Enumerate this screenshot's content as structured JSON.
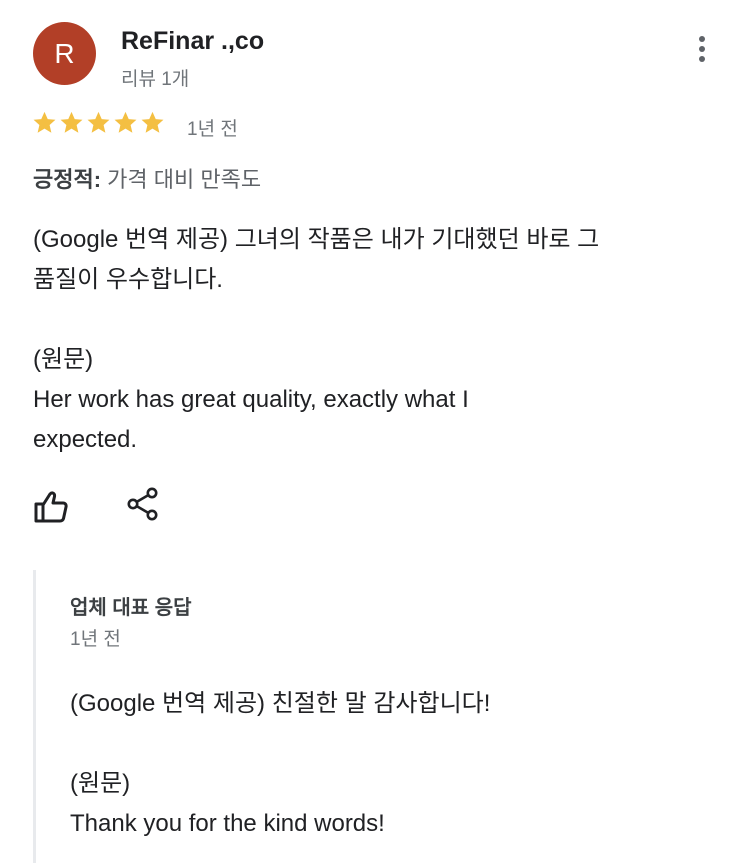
{
  "review": {
    "author": {
      "initial": "R",
      "name": "ReFinar .,co",
      "meta": "리뷰 1개",
      "avatar_color": "#b23f27"
    },
    "more_menu_icon": "more-vert-icon",
    "rating": {
      "stars": 5,
      "max": 5,
      "star_color": "#f4bf42",
      "star_icon": "star-icon"
    },
    "date": "1년 전",
    "attributes": {
      "label": "긍정적:",
      "value": " 가격 대비 만족도"
    },
    "body": {
      "translated_line1": "(Google 번역 제공) 그녀의 작품은 내가 기대했던 바로 그",
      "translated_line2": "품질이 우수합니다.",
      "original_label": "(원문)",
      "original_line1": "Her work has great quality, exactly what I",
      "original_line2": "expected."
    },
    "actions": {
      "like_icon": "thumbs-up-icon",
      "share_icon": "share-icon"
    }
  },
  "owner_response": {
    "title": "업체 대표 응답",
    "date": "1년 전",
    "translated": "(Google 번역 제공) 친절한 말 감사합니다!",
    "original_label": "(원문)",
    "original": "Thank you for the kind words!"
  }
}
